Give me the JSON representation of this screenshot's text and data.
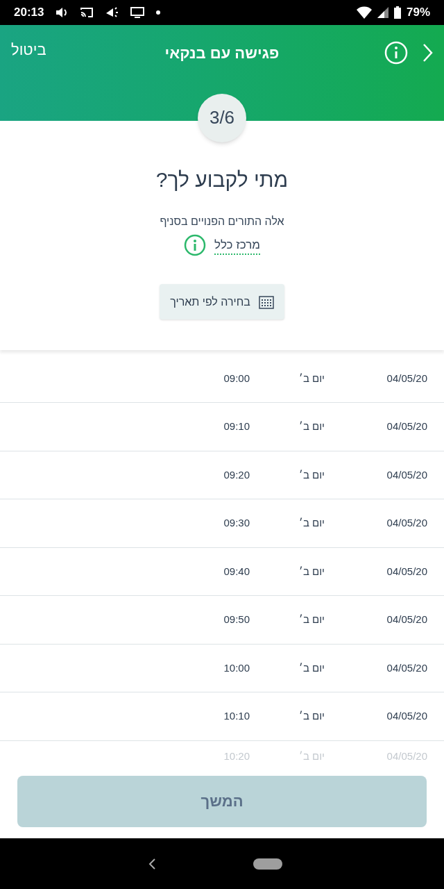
{
  "status_bar": {
    "time": "20:13",
    "battery": "79%"
  },
  "header": {
    "title": "פגישה עם בנקאי",
    "cancel": "ביטול",
    "step": "3/6"
  },
  "question": "מתי לקבוע לך?",
  "branch_intro": "אלה התורים הפנויים בסניף",
  "branch_name": "מרכז כלל",
  "date_button": "בחירה לפי תאריך",
  "slots": [
    {
      "date": "04/05/20",
      "day": "יום ב׳",
      "time": "09:00",
      "faded": false
    },
    {
      "date": "04/05/20",
      "day": "יום ב׳",
      "time": "09:10",
      "faded": false
    },
    {
      "date": "04/05/20",
      "day": "יום ב׳",
      "time": "09:20",
      "faded": false
    },
    {
      "date": "04/05/20",
      "day": "יום ב׳",
      "time": "09:30",
      "faded": false
    },
    {
      "date": "04/05/20",
      "day": "יום ב׳",
      "time": "09:40",
      "faded": false
    },
    {
      "date": "04/05/20",
      "day": "יום ב׳",
      "time": "09:50",
      "faded": false
    },
    {
      "date": "04/05/20",
      "day": "יום ב׳",
      "time": "10:00",
      "faded": false
    },
    {
      "date": "04/05/20",
      "day": "יום ב׳",
      "time": "10:10",
      "faded": false
    },
    {
      "date": "04/05/20",
      "day": "יום ב׳",
      "time": "10:20",
      "faded": true
    }
  ],
  "continue_button": {
    "label": "המשך",
    "disabled": true
  }
}
